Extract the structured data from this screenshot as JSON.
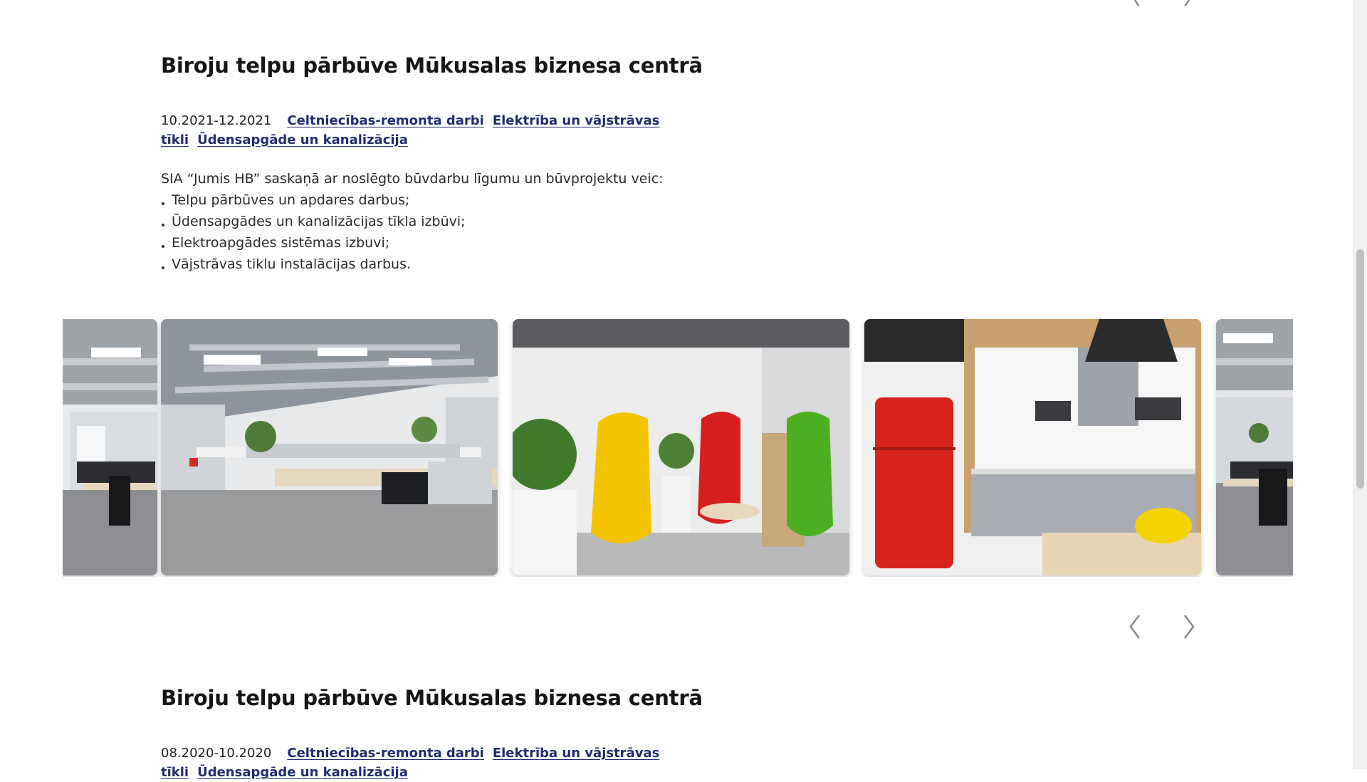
{
  "projects": [
    {
      "title": "Biroju telpu pārbūve Mūkusalas biznesa centrā",
      "date": "10.2021-12.2021",
      "tags": [
        "Celtniecības-remonta darbi",
        "Elektrība un vājstrāvas tīkli",
        "Ūdensapgāde un kanalizācija"
      ],
      "intro": "SIA “Jumis HB” saskaņā ar noslēgto būvdarbu līgumu un būvprojektu veic:",
      "items": [
        "Telpu pārbūves un apdares darbus;",
        "Ūdensapgādes un kanalizācijas tīkla izbūvi;",
        "Elektroapgādes sistēmas izbuvi;",
        "Vājstrāvas tiklu instalācijas darbus."
      ]
    },
    {
      "title": "Biroju telpu pārbūve Mūkusalas biznesa centrā",
      "date": "08.2020-10.2020",
      "tags": [
        "Celtniecības-remonta darbi",
        "Elektrība un vājstrāvas tīkli",
        "Ūdensapgāde un kanalizācija"
      ]
    }
  ],
  "carousel": {
    "slides": [
      {
        "name": "office-open-space-partial"
      },
      {
        "name": "office-open-space"
      },
      {
        "name": "lounge-chairs"
      },
      {
        "name": "kitchenette"
      },
      {
        "name": "office-workstations-partial"
      }
    ]
  },
  "colors": {
    "link": "#1e2e6e",
    "heading": "#151515"
  },
  "icons": {
    "prev": "chevron-left-icon",
    "next": "chevron-right-icon"
  }
}
